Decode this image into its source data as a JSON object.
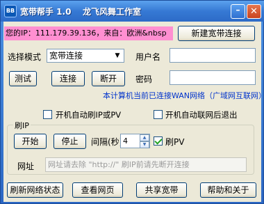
{
  "window": {
    "app_icon_text": "BB",
    "title": "宽带帮手 1.0",
    "studio": "龙飞风舞工作室",
    "minimize": "–",
    "close": "✕"
  },
  "ip_info": "您的IP：111.179.39.136，来自：欧洲&nbsp",
  "buttons": {
    "new_connection": "新建宽带连接",
    "test": "测试",
    "connect": "连接",
    "disconnect": "断开",
    "start": "开始",
    "stop": "停止",
    "refresh_status": "刷新网络状态",
    "view_page": "查看网页",
    "share_broadband": "共享宽带",
    "help_about": "帮助和关于"
  },
  "mode": {
    "label": "选择模式",
    "selected": "宽带连接"
  },
  "username": {
    "label": "用户名",
    "value": ""
  },
  "password": {
    "label": "密码",
    "value": ""
  },
  "connection_status": "本计算机当前已连接WAN网络（广域网互联网）",
  "options": {
    "auto_refresh_ip_pv": "开机自动刷IP或PV",
    "auto_connect_exit": "开机自动联网后退出"
  },
  "refresh_group": {
    "title": "刷IP",
    "interval_label": "间隔(秒)",
    "interval_value": "4",
    "pv_label": "刷PV",
    "pv_checked": true,
    "url_label": "网址",
    "url_placeholder": "网址请去除 \"http://\"  刷IP前请先断开连接"
  }
}
